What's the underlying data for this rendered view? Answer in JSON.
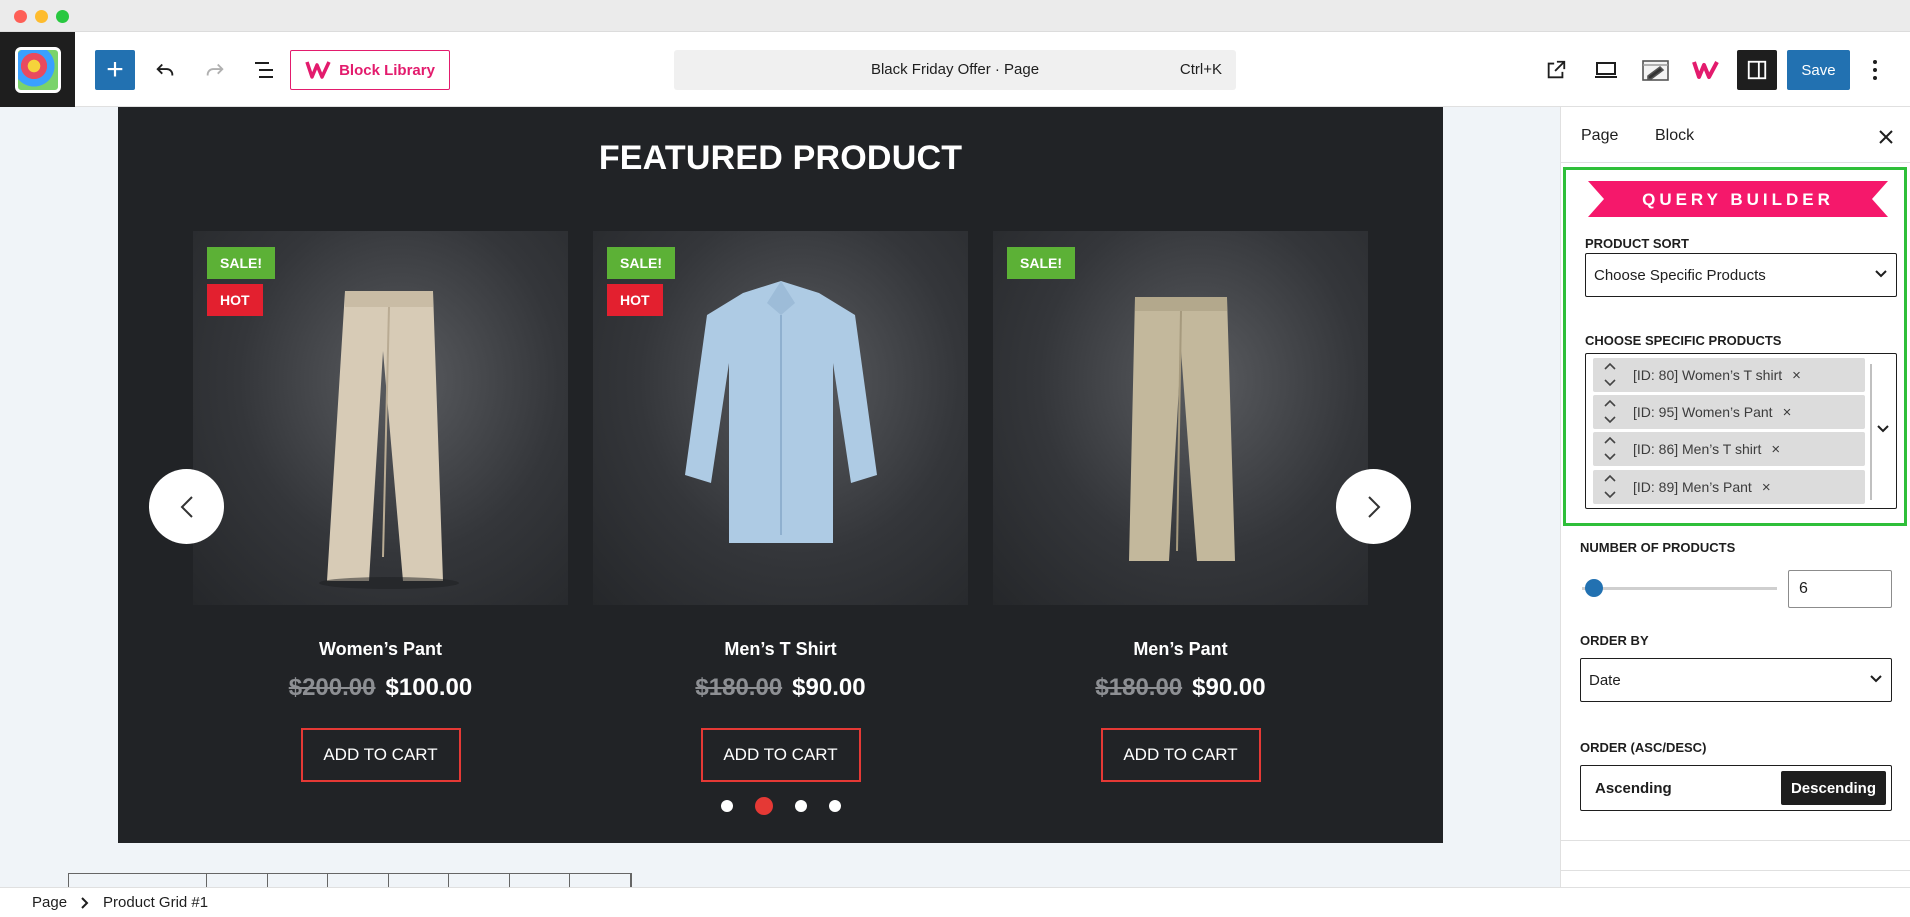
{
  "window": {
    "controls": [
      "close",
      "minimize",
      "maximize"
    ]
  },
  "toolbar": {
    "block_library_label": "Block Library",
    "document_title": "Black Friday Offer · Page",
    "shortcut": "Ctrl+K",
    "save_label": "Save",
    "icons": [
      "add-block-icon",
      "undo-icon",
      "redo-icon",
      "document-overview-icon",
      "block-library-icon",
      "view-page-icon",
      "preview-device-icon",
      "template-edit-icon",
      "wowstore-icon",
      "settings-sidebar-icon",
      "options-icon"
    ]
  },
  "canvas": {
    "section_title": "FEATURED PRODUCT",
    "products": [
      {
        "name": "Women’s Pant",
        "old_price": "$200.00",
        "new_price": "$100.00",
        "cart_label": "ADD TO CART",
        "sale_tag": "SALE!",
        "hot_tag": "HOT"
      },
      {
        "name": "Men’s T Shirt",
        "old_price": "$180.00",
        "new_price": "$90.00",
        "cart_label": "ADD TO CART",
        "sale_tag": "SALE!",
        "hot_tag": "HOT"
      },
      {
        "name": "Men’s Pant",
        "old_price": "$180.00",
        "new_price": "$90.00",
        "cart_label": "ADD TO CART",
        "sale_tag": "SALE!"
      }
    ],
    "pagination": {
      "pages": 4,
      "active_index": 1
    }
  },
  "breadcrumb": {
    "root": "Page",
    "current": "Product Grid #1"
  },
  "sidebar": {
    "tabs": [
      "Page",
      "Block"
    ],
    "query_builder_title": "QUERY BUILDER",
    "product_sort_label": "PRODUCT SORT",
    "product_sort_value": "Choose Specific Products",
    "choose_products_label": "CHOOSE SPECIFIC PRODUCTS",
    "selected_products": [
      {
        "label": "[ID: 80] Women’s T shirt",
        "remove": "×"
      },
      {
        "label": "[ID: 95] Women’s Pant",
        "remove": "×"
      },
      {
        "label": "[ID: 86] Men’s T shirt",
        "remove": "×"
      },
      {
        "label": "[ID: 89] Men’s Pant",
        "remove": "×"
      }
    ],
    "number_label": "NUMBER OF PRODUCTS",
    "number_value": "6",
    "order_by_label": "ORDER BY",
    "order_by_value": "Date",
    "order_label": "ORDER (ASC/DESC)",
    "order_options": {
      "asc": "Ascending",
      "desc": "Descending"
    },
    "order_selected": "Descending"
  },
  "colors": {
    "primary": "#2271b1",
    "brand_pink": "#e31b6d",
    "highlight_frame": "#2fbf39",
    "sale_tag": "#5cb136",
    "hot_tag": "#e3202f",
    "cart_border": "#e53935",
    "block_background": "#212326"
  }
}
